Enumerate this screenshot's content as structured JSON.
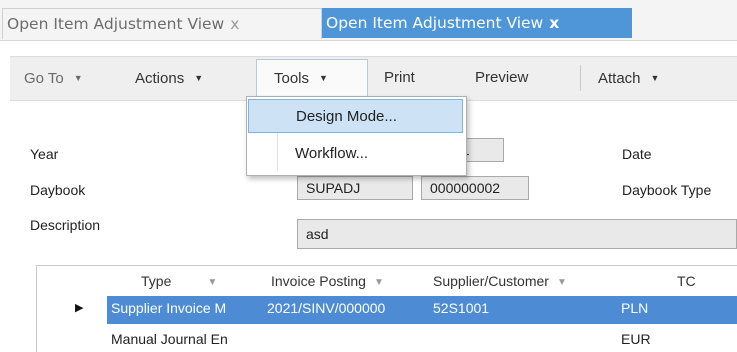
{
  "tabs": [
    {
      "label": "Open Item Adjustment View",
      "close": "x",
      "active": false
    },
    {
      "label": "Open Item Adjustment View",
      "close": "x",
      "active": true
    }
  ],
  "toolbar": {
    "goto": "Go To",
    "actions": "Actions",
    "tools": "Tools",
    "print": "Print",
    "preview": "Preview",
    "attach": "Attach",
    "caret": "▼"
  },
  "tools_menu": {
    "items": [
      "Design Mode...",
      "Workflow..."
    ]
  },
  "form": {
    "year_label": "Year",
    "year_value": "11",
    "date_label": "Date",
    "daybook_label": "Daybook",
    "daybook_code": "SUPADJ",
    "daybook_number": "000000002",
    "daybook_type_label": "Daybook Type",
    "description_label": "Description",
    "description_value": "asd"
  },
  "grid": {
    "columns": [
      "Type",
      "Invoice Posting",
      "Supplier/Customer",
      "TC"
    ],
    "rows": [
      {
        "type": "Supplier Invoice M",
        "invoice_posting": "2021/SINV/000000",
        "supplier_customer": "52S1001",
        "tc": "PLN",
        "selected": true
      },
      {
        "type": "Manual Journal En",
        "invoice_posting": "",
        "supplier_customer": "",
        "tc": "EUR",
        "selected": false
      }
    ]
  },
  "colors": {
    "active_tab": "#4e96d8",
    "selected_row": "#4d8bd4",
    "menu_highlight": "#cde2f5"
  }
}
